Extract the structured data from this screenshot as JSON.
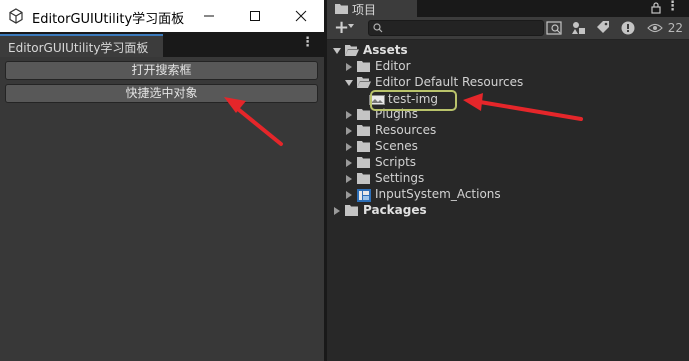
{
  "editor_window": {
    "title": "EditorGUIUtility学习面板",
    "tab_label": "EditorGUIUtility学习面板",
    "buttons": {
      "open_search": "打开搜索框",
      "quick_select": "快捷选中对象"
    }
  },
  "project_window": {
    "tab_label": "项目",
    "search": {
      "value": "",
      "placeholder": ""
    },
    "hidden_count": "22",
    "tree": [
      {
        "label": "Assets",
        "bold": true,
        "expanded": true,
        "icon": "folder-open-icon"
      },
      {
        "label": "Editor",
        "bold": false,
        "expanded": false,
        "icon": "folder-icon"
      },
      {
        "label": "Editor Default Resources",
        "bold": false,
        "expanded": true,
        "icon": "folder-open-icon"
      },
      {
        "label": "test-img",
        "bold": false,
        "expanded": null,
        "icon": "image-asset-icon"
      },
      {
        "label": "Plugins",
        "bold": false,
        "expanded": false,
        "icon": "folder-icon"
      },
      {
        "label": "Resources",
        "bold": false,
        "expanded": false,
        "icon": "folder-icon"
      },
      {
        "label": "Scenes",
        "bold": false,
        "expanded": false,
        "icon": "folder-icon"
      },
      {
        "label": "Scripts",
        "bold": false,
        "expanded": false,
        "icon": "folder-icon"
      },
      {
        "label": "Settings",
        "bold": false,
        "expanded": false,
        "icon": "folder-icon"
      },
      {
        "label": "InputSystem_Actions",
        "bold": false,
        "expanded": false,
        "icon": "input-actions-icon"
      },
      {
        "label": "Packages",
        "bold": true,
        "expanded": false,
        "icon": "folder-icon"
      }
    ]
  },
  "colors": {
    "annotation_arrow": "#e5262a",
    "highlight_outline": "#b9c36b",
    "tab_accent": "#3a79bb"
  }
}
